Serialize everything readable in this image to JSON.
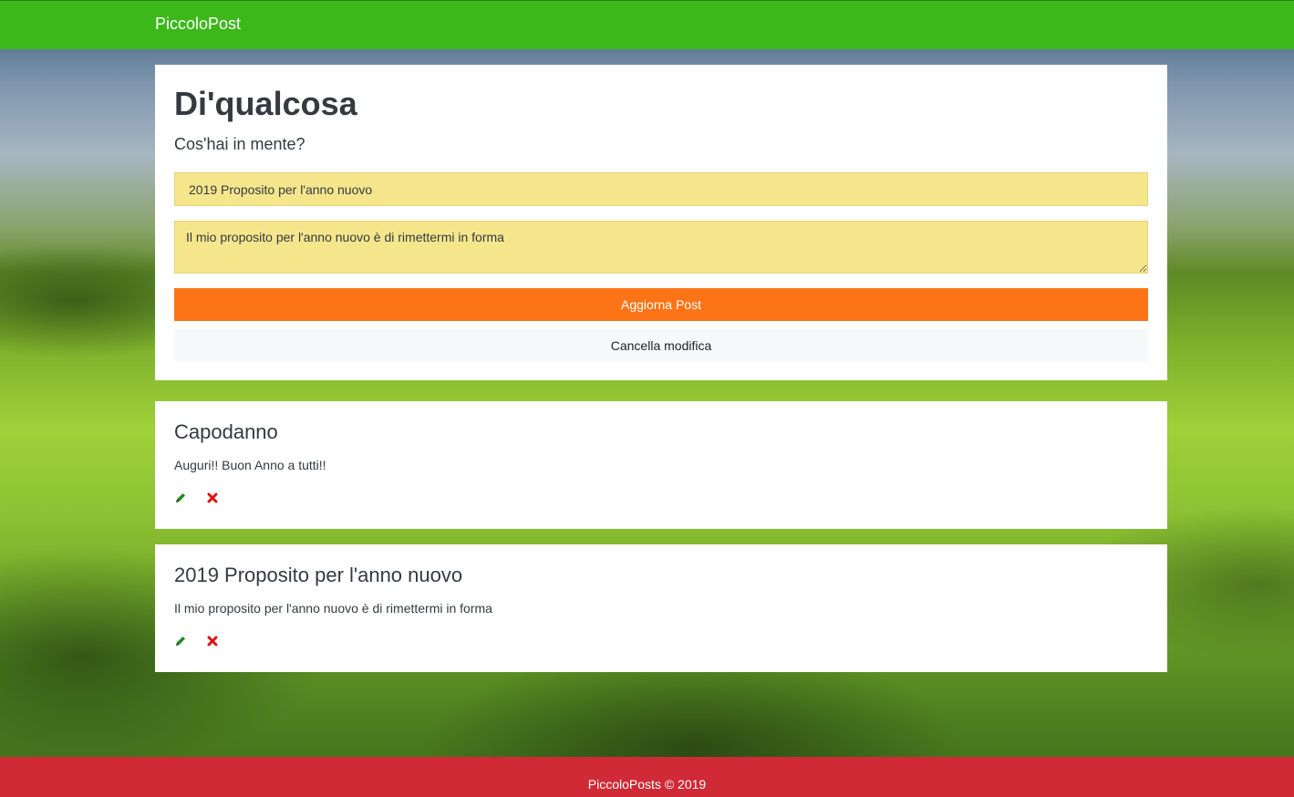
{
  "navbar": {
    "brand": "PiccoloPost"
  },
  "form": {
    "heading": "Di'qualcosa",
    "lead": "Cos'hai in mente?",
    "title_value": "2019 Proposito per l'anno nuovo",
    "body_value": "Il mio proposito per l'anno nuovo è di rimettermi in forma",
    "update_label": "Aggiorna Post",
    "cancel_label": "Cancella modifica"
  },
  "posts": [
    {
      "title": "Capodanno",
      "body": "Auguri!! Buon Anno a tutti!!"
    },
    {
      "title": "2019 Proposito per l'anno nuovo",
      "body": "Il mio proposito per l'anno nuovo è di rimettermi in forma"
    }
  ],
  "icons": {
    "edit": "pencil-icon",
    "delete": "close-icon"
  },
  "colors": {
    "navbar": "#3cb81b",
    "footer": "#d02a36",
    "update_button": "#fd7417",
    "input_bg": "#f5e68c",
    "edit_icon": "#1e8a1e",
    "delete_icon": "#e01010"
  },
  "footer": {
    "text": "PiccoloPosts © 2019"
  }
}
